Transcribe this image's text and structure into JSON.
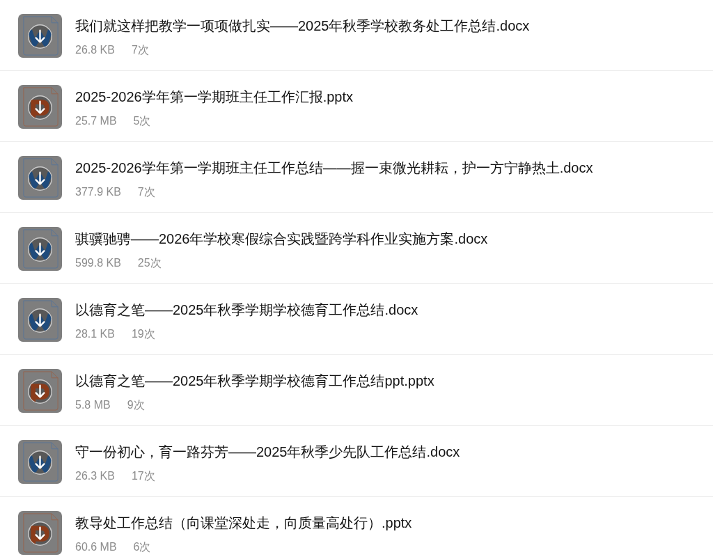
{
  "files": [
    {
      "kind": "word",
      "name": "我们就这样把教学一项项做扎实——2025年秋季学校教务处工作总结.docx",
      "size": "26.8 KB",
      "count": "7次"
    },
    {
      "kind": "presentation",
      "name": "2025-2026学年第一学期班主任工作汇报.pptx",
      "size": "25.7 MB",
      "count": "5次"
    },
    {
      "kind": "word",
      "name": "2025-2026学年第一学期班主任工作总结——握一束微光耕耘，护一方宁静热土.docx",
      "size": "377.9 KB",
      "count": "7次"
    },
    {
      "kind": "word",
      "name": "骐骥驰骋——2026年学校寒假综合实践暨跨学科作业实施方案.docx",
      "size": "599.8 KB",
      "count": "25次"
    },
    {
      "kind": "word",
      "name": "以德育之笔——2025年秋季学期学校德育工作总结.docx",
      "size": "28.1 KB",
      "count": "19次"
    },
    {
      "kind": "presentation",
      "name": "以德育之笔——2025年秋季学期学校德育工作总结ppt.pptx",
      "size": "5.8 MB",
      "count": "9次"
    },
    {
      "kind": "word",
      "name": "守一份初心，育一路芬芳——2025年秋季少先队工作总结.docx",
      "size": "26.3 KB",
      "count": "17次"
    },
    {
      "kind": "presentation",
      "name": "教导处工作总结（向课堂深处走，向质量高处行）.pptx",
      "size": "60.6 MB",
      "count": "6次"
    }
  ]
}
